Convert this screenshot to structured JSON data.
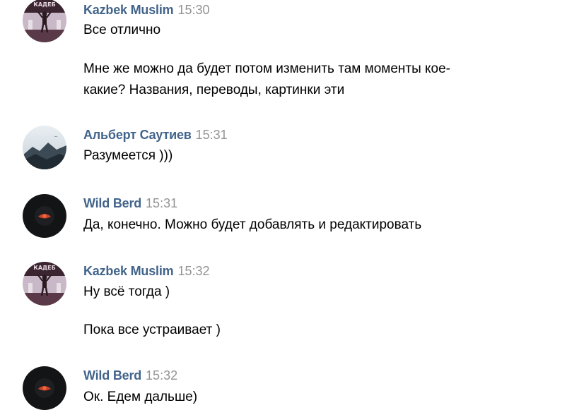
{
  "messages": [
    {
      "author": "Kazbek Muslim",
      "time": "15:30",
      "avatar_icon": "gym-avatar",
      "lines": [
        "Все отлично",
        "Мне же можно да будет потом изменить там моменты кое-",
        "какие? Названия, переводы, картинки эти"
      ]
    },
    {
      "author": "Альберт Саутиев",
      "time": "15:31",
      "avatar_icon": "mountain-avatar",
      "lines": [
        "Разумеется )))"
      ]
    },
    {
      "author": "Wild Berd",
      "time": "15:31",
      "avatar_icon": "dark-avatar",
      "lines": [
        "Да, конечно. Можно будет добавлять и редактировать"
      ]
    },
    {
      "author": "Kazbek Muslim",
      "time": "15:32",
      "avatar_icon": "gym-avatar",
      "lines": [
        "Ну всё тогда )",
        "Пока все устраивает )"
      ]
    },
    {
      "author": "Wild Berd",
      "time": "15:32",
      "avatar_icon": "dark-avatar",
      "lines": [
        "Ок. Едем дальше)"
      ]
    }
  ],
  "colors": {
    "author": "#42648b",
    "time": "#939393",
    "text": "#000000",
    "background": "#ffffff"
  }
}
